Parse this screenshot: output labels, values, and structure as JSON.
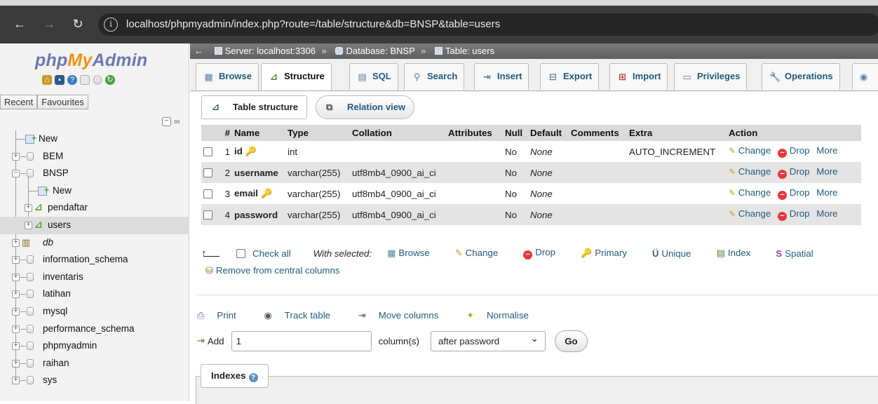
{
  "browser": {
    "url": "localhost/phpmyadmin/index.php?route=/table/structure&db=BNSP&table=users"
  },
  "sidebar": {
    "logo": {
      "php": "php",
      "my": "My",
      "admin": "Admin"
    },
    "recent_label": "Recent",
    "favourites_label": "Favourites",
    "tree": [
      {
        "label": "New",
        "type": "new",
        "level": 0
      },
      {
        "label": "BEM",
        "type": "db",
        "level": 0
      },
      {
        "label": "BNSP",
        "type": "db",
        "level": 0,
        "expanded": true
      },
      {
        "label": "New",
        "type": "new",
        "level": 1
      },
      {
        "label": "pendaftar",
        "type": "table",
        "level": 1
      },
      {
        "label": "users",
        "type": "table",
        "level": 1,
        "selected": true
      },
      {
        "label": "db",
        "type": "db-special",
        "level": 0
      },
      {
        "label": "information_schema",
        "type": "db",
        "level": 0
      },
      {
        "label": "inventaris",
        "type": "db",
        "level": 0
      },
      {
        "label": "latihan",
        "type": "db",
        "level": 0
      },
      {
        "label": "mysql",
        "type": "db",
        "level": 0
      },
      {
        "label": "performance_schema",
        "type": "db",
        "level": 0
      },
      {
        "label": "phpmyadmin",
        "type": "db",
        "level": 0
      },
      {
        "label": "raihan",
        "type": "db",
        "level": 0
      },
      {
        "label": "sys",
        "type": "db",
        "level": 0
      }
    ]
  },
  "breadcrumb": {
    "server": "Server: localhost:3306",
    "database": "Database: BNSP",
    "table": "Table: users",
    "separator": "»"
  },
  "tabs": [
    {
      "label": "Browse",
      "icon": "browse-icon"
    },
    {
      "label": "Structure",
      "icon": "structure-icon",
      "active": true
    },
    {
      "label": "SQL",
      "icon": "sql-icon"
    },
    {
      "label": "Search",
      "icon": "search-icon"
    },
    {
      "label": "Insert",
      "icon": "insert-icon"
    },
    {
      "label": "Export",
      "icon": "export-icon"
    },
    {
      "label": "Import",
      "icon": "import-icon"
    },
    {
      "label": "Privileges",
      "icon": "privileges-icon"
    },
    {
      "label": "Operations",
      "icon": "operations-icon"
    }
  ],
  "subtabs": {
    "table_structure": "Table structure",
    "relation_view": "Relation view"
  },
  "columns_header": [
    "#",
    "Name",
    "Type",
    "Collation",
    "Attributes",
    "Null",
    "Default",
    "Comments",
    "Extra",
    "Action"
  ],
  "columns": [
    {
      "num": "1",
      "name": "id",
      "key": "primary",
      "type": "int",
      "collation": "",
      "attributes": "",
      "null": "No",
      "default": "None",
      "comments": "",
      "extra": "AUTO_INCREMENT"
    },
    {
      "num": "2",
      "name": "username",
      "key": "",
      "type": "varchar(255)",
      "collation": "utf8mb4_0900_ai_ci",
      "attributes": "",
      "null": "No",
      "default": "None",
      "comments": "",
      "extra": ""
    },
    {
      "num": "3",
      "name": "email",
      "key": "unique",
      "type": "varchar(255)",
      "collation": "utf8mb4_0900_ai_ci",
      "attributes": "",
      "null": "No",
      "default": "None",
      "comments": "",
      "extra": ""
    },
    {
      "num": "4",
      "name": "password",
      "key": "",
      "type": "varchar(255)",
      "collation": "utf8mb4_0900_ai_ci",
      "attributes": "",
      "null": "No",
      "default": "None",
      "comments": "",
      "extra": ""
    }
  ],
  "row_actions": {
    "change": "Change",
    "drop": "Drop",
    "more": "More"
  },
  "bulk": {
    "check_all": "Check all",
    "with_selected": "With selected:",
    "browse": "Browse",
    "change": "Change",
    "drop": "Drop",
    "primary": "Primary",
    "unique": "Unique",
    "index": "Index",
    "spatial": "Spatial",
    "remove_central": "Remove from central columns"
  },
  "tools": {
    "print": "Print",
    "track_table": "Track table",
    "move_columns": "Move columns",
    "normalise": "Normalise"
  },
  "add_columns": {
    "add_label": "Add",
    "count_value": "1",
    "columns_label": "column(s)",
    "position_selected": "after password",
    "go_label": "Go"
  },
  "indexes": {
    "label": "Indexes"
  }
}
